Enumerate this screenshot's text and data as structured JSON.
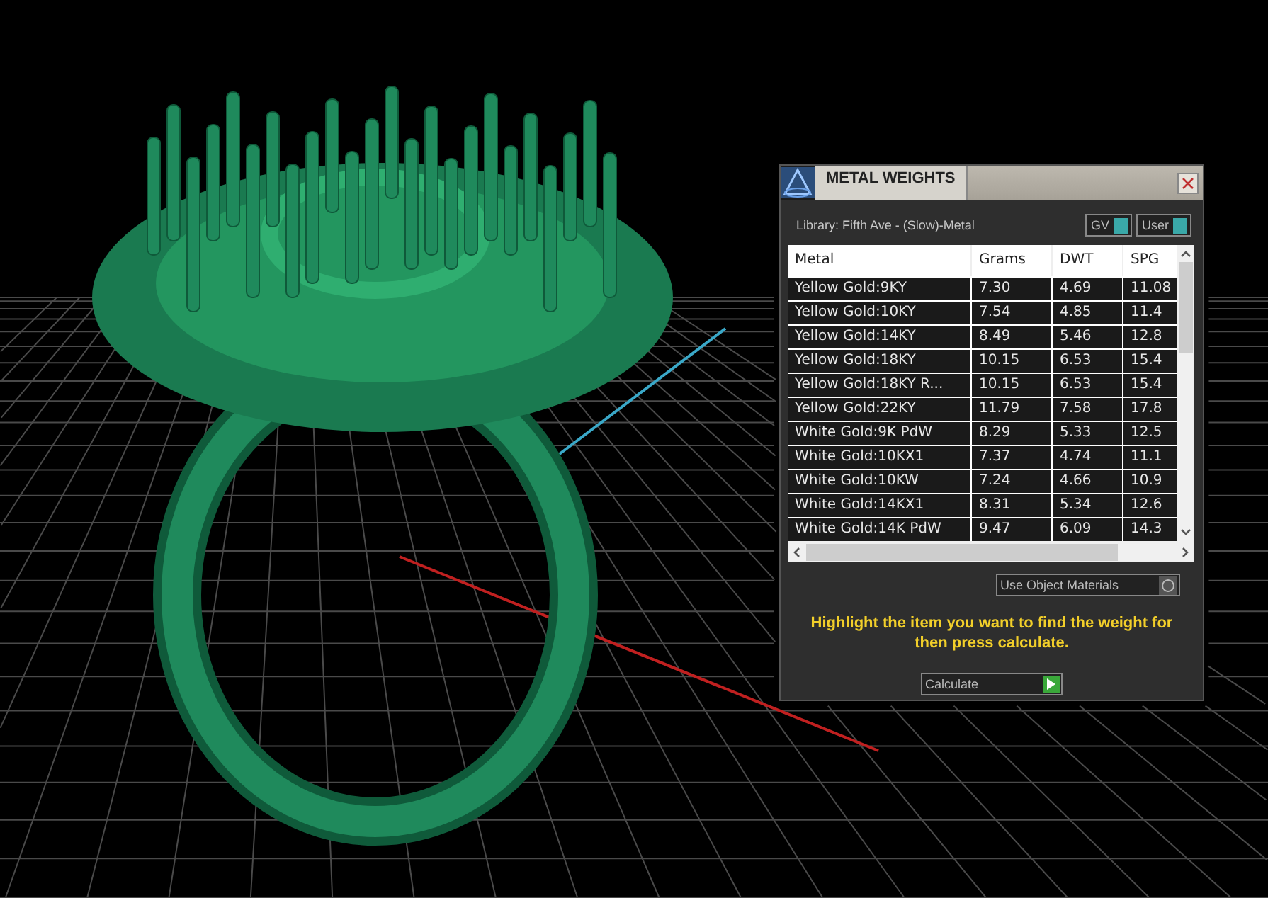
{
  "panel": {
    "title": "METAL WEIGHTS",
    "library": "Library: Fifth Ave - (Slow)-Metal",
    "toggles": [
      {
        "label": "GV",
        "on": true
      },
      {
        "label": "User",
        "on": true
      }
    ],
    "table": {
      "columns": [
        "Metal",
        "Grams",
        "DWT",
        "SPG"
      ],
      "rows": [
        {
          "cells": [
            "Yellow Gold:9KY",
            "7.30",
            "4.69",
            "11.08"
          ],
          "selected": false
        },
        {
          "cells": [
            "Yellow Gold:10KY",
            "7.54",
            "4.85",
            "11.4"
          ],
          "selected": false
        },
        {
          "cells": [
            "Yellow Gold:14KY",
            "8.49",
            "5.46",
            "12.8"
          ],
          "selected": false
        },
        {
          "cells": [
            "Yellow Gold:18KY",
            "10.15",
            "6.53",
            "15.4"
          ],
          "selected": false
        },
        {
          "cells": [
            "Yellow Gold:18KY R...",
            "10.15",
            "6.53",
            "15.4"
          ],
          "selected": false
        },
        {
          "cells": [
            "Yellow Gold:22KY",
            "11.79",
            "7.58",
            "17.8"
          ],
          "selected": false
        },
        {
          "cells": [
            "White Gold:9K PdW",
            "8.29",
            "5.33",
            "12.5"
          ],
          "selected": false
        },
        {
          "cells": [
            "White Gold:10KX1",
            "7.37",
            "4.74",
            "11.1"
          ],
          "selected": false
        },
        {
          "cells": [
            "White Gold:10KW",
            "7.24",
            "4.66",
            "10.9"
          ],
          "selected": false
        },
        {
          "cells": [
            "White Gold:14KX1",
            "8.31",
            "5.34",
            "12.6"
          ],
          "selected": false
        },
        {
          "cells": [
            "White Gold:14K PdW",
            "9.47",
            "6.09",
            "14.3"
          ],
          "selected": false
        }
      ]
    },
    "option": {
      "label": "Use Object Materials",
      "on": false
    },
    "hint": "Highlight the item you want to find the weight for then press calculate.",
    "button": "Calculate"
  }
}
